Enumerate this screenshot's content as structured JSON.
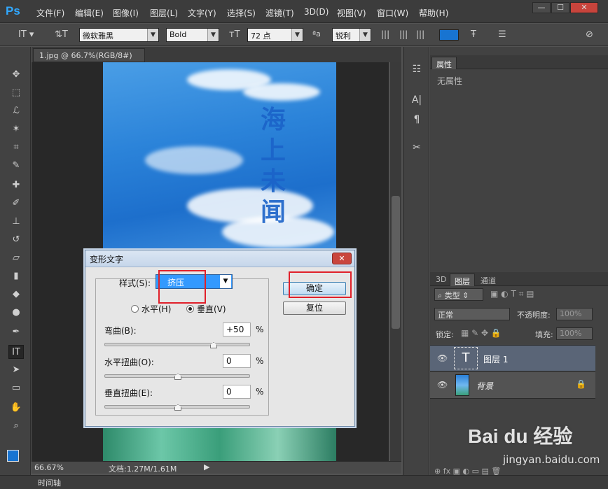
{
  "app": {
    "logo": "Ps"
  },
  "menu": [
    "文件(F)",
    "编辑(E)",
    "图像(I)",
    "图层(L)",
    "文字(Y)",
    "选择(S)",
    "滤镜(T)",
    "3D(D)",
    "视图(V)",
    "窗口(W)",
    "帮助(H)"
  ],
  "window_buttons": {
    "min": "—",
    "max": "☐",
    "close": "✕"
  },
  "options": {
    "font_family": "微软雅黑",
    "font_style": "Bold",
    "font_size": "72 点",
    "aa_label": "ªa",
    "antialias": "锐利",
    "color_swatch": "#1874d1"
  },
  "document": {
    "tab_title": "1.jpg @ 66.7%(RGB/8#)",
    "tab_close": "×",
    "vertical_text": [
      "海",
      "上",
      "未",
      "闻"
    ],
    "text_color": "#1b63c9"
  },
  "status": {
    "zoom": "66.67%",
    "doc_info": "文档:1.27M/1.61M"
  },
  "timeline": {
    "label": "时间轴"
  },
  "properties": {
    "tab": "属性",
    "empty": "无属性"
  },
  "layers": {
    "tabs": [
      "3D",
      "图层",
      "通道"
    ],
    "filter_kind": "类型",
    "blend_mode": "正常",
    "opacity_label": "不透明度:",
    "opacity_value": "100%",
    "lock_label": "锁定:",
    "fill_label": "填充:",
    "fill_value": "100%",
    "items": [
      {
        "name": "图层 1",
        "thumb": "T"
      },
      {
        "name": "背景"
      }
    ]
  },
  "dialog": {
    "title": "变形文字",
    "close": "✕",
    "style_label": "样式(S):",
    "style_value": "挤压",
    "orient_horizontal": "水平(H)",
    "orient_vertical": "垂直(V)",
    "orientation": "vertical",
    "bend_label": "弯曲(B):",
    "bend_value": "+50",
    "hdist_label": "水平扭曲(O):",
    "hdist_value": "0",
    "vdist_label": "垂直扭曲(E):",
    "vdist_value": "0",
    "percent": "%",
    "ok": "确定",
    "reset": "复位"
  },
  "annotations": {
    "highlight_color": "#e0202a"
  },
  "watermark": {
    "brand": "Bai du 经验",
    "url": "jingyan.baidu.com"
  }
}
